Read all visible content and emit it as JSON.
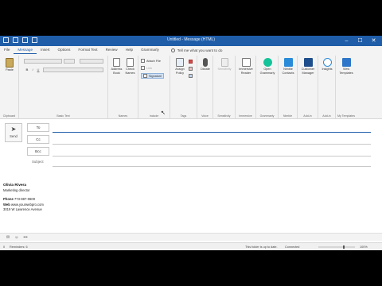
{
  "window": {
    "title": "Untitled - Message (HTML)",
    "min": "–",
    "max": "☐",
    "close": "✕"
  },
  "tabs": [
    "File",
    "Message",
    "Insert",
    "Options",
    "Format Text",
    "Review",
    "Help",
    "Grammarly"
  ],
  "active_tab": "Message",
  "tell_me": "Tell me what you want to do",
  "clipboard": {
    "paste": "Paste",
    "label": "Clipboard"
  },
  "basic_text": {
    "label": "Basic Text",
    "bold": "B",
    "italic": "I",
    "underline": "U"
  },
  "names": {
    "address_book": "Address Book",
    "check_names": "Check Names",
    "label": "Names"
  },
  "include": {
    "attach_file": "Attach File",
    "link": "Link",
    "signature": "Signature",
    "label": "Include"
  },
  "tags": {
    "assign_policy": "Assign Policy",
    "label": "Tags"
  },
  "voice": {
    "dictate": "Dictate",
    "label": "Voice"
  },
  "sensitivity": {
    "button": "Sensitivity",
    "label": "Sensitivity"
  },
  "immersive": {
    "button": "Immersive Reader",
    "label": "Immersive"
  },
  "grammarly": {
    "button": "Open Grammarly",
    "label": "Grammarly"
  },
  "nimble": {
    "button": "Nimble Contacts",
    "label": "Nimble"
  },
  "addin1": {
    "button": "Customer Manager",
    "label": "Add-in"
  },
  "addin2": {
    "button": "Insights",
    "label": "Add-in"
  },
  "templates": {
    "button": "View Templates",
    "label": "My Templates"
  },
  "compose": {
    "send": "Send",
    "to": "To",
    "cc": "Cc",
    "bcc": "Bcc",
    "subject": "Subject"
  },
  "signature": {
    "name": "Olivia Rivera",
    "title": "Marketing director",
    "phone_label": "Phone",
    "phone": "773-697-0600",
    "web_label": "Web",
    "web": "www.yourwebpro.com",
    "address": "3019 W Lawrence Avenue"
  },
  "bottom": {
    "more": "•••"
  },
  "status": {
    "left_glyph": "0",
    "reminders": "Reminders: 6",
    "folder_status": "This folder is up to date.",
    "connected": "Connected",
    "zoom": "100%"
  },
  "colors": {
    "accent": "#1f5da8",
    "grammarly": "#15c39a",
    "nimble": "#2a8bd8",
    "templates": "#2d76c9"
  }
}
